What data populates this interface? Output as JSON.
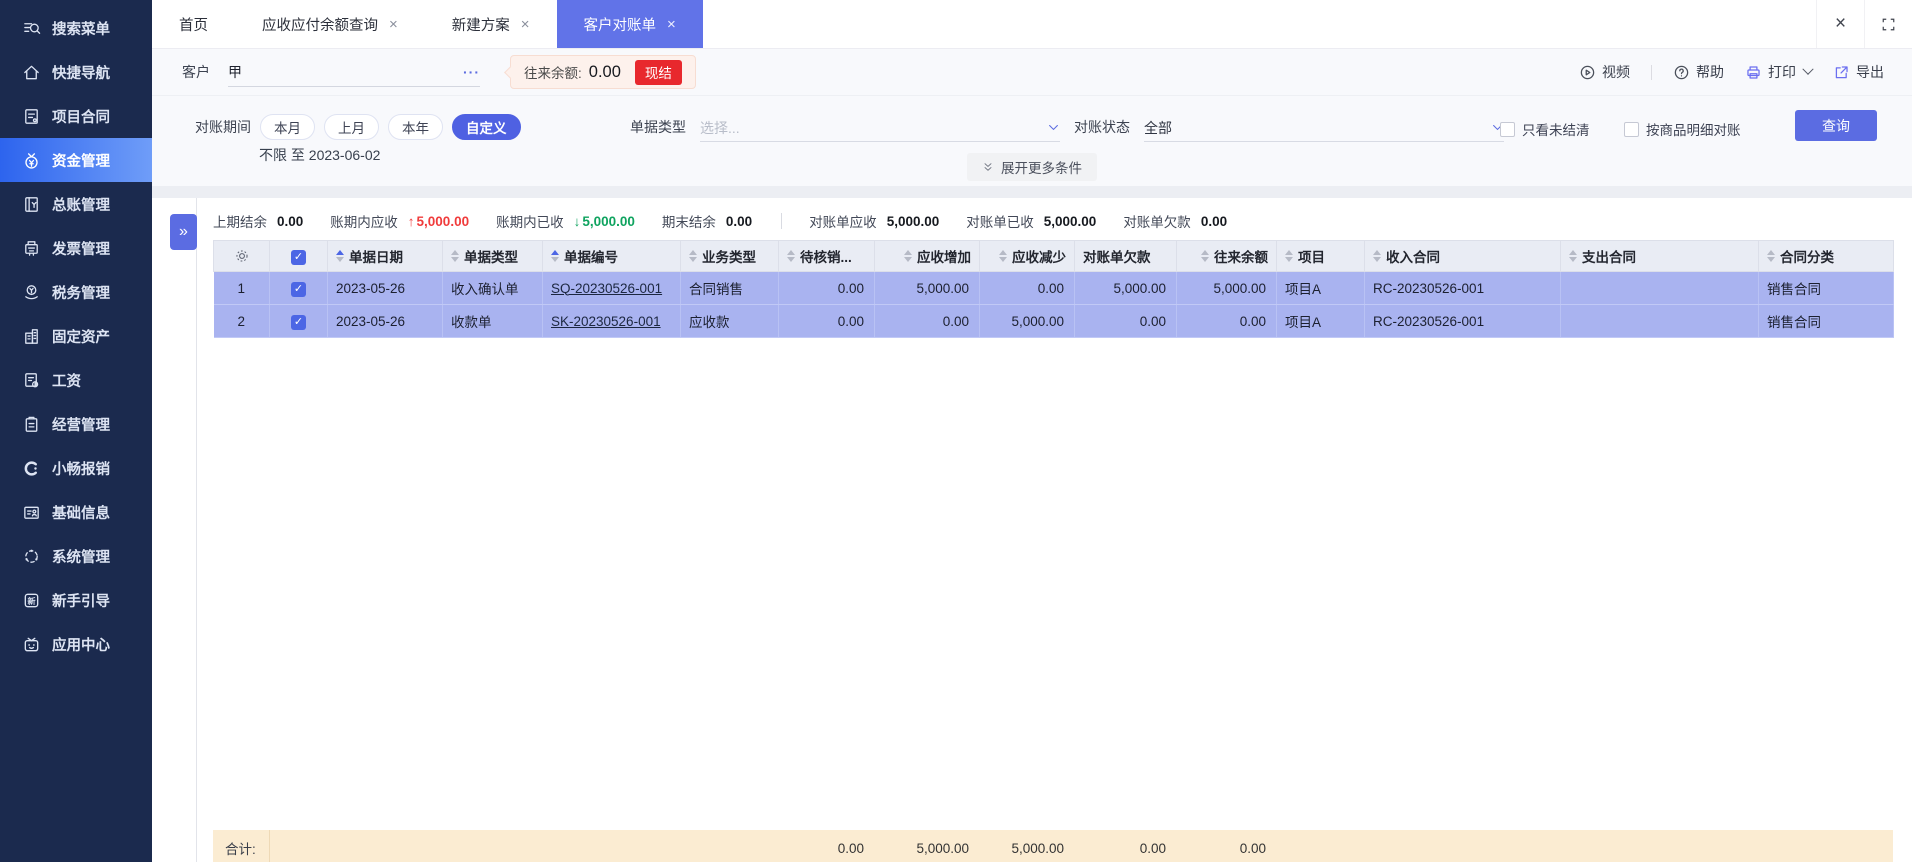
{
  "glyphs": {
    "close": "×",
    "ellipsis": "···",
    "check": "✓",
    "arrow_up": "↑",
    "arrow_down": "↓",
    "expander": "»"
  },
  "colors": {
    "sidebar_bg": "#1b2a4e",
    "accent_blue": "#5b6ce2",
    "active_tab": "#6173e8",
    "row_selected": "#a9b3f0",
    "badge_red": "#e8282d",
    "value_red": "#f03b3b",
    "value_green": "#0fa35f",
    "totals_bg": "#fbecd2"
  },
  "sidebar": {
    "items": [
      {
        "label": "搜索菜单"
      },
      {
        "label": "快捷导航"
      },
      {
        "label": "项目合同"
      },
      {
        "label": "资金管理",
        "active": true
      },
      {
        "label": "总账管理"
      },
      {
        "label": "发票管理"
      },
      {
        "label": "税务管理"
      },
      {
        "label": "固定资产"
      },
      {
        "label": "工资"
      },
      {
        "label": "经营管理"
      },
      {
        "label": "小畅报销"
      },
      {
        "label": "基础信息"
      },
      {
        "label": "系统管理"
      },
      {
        "label": "新手引导"
      },
      {
        "label": "应用中心"
      }
    ]
  },
  "tabs": [
    {
      "label": "首页",
      "closable": false
    },
    {
      "label": "应收应付余额查询",
      "closable": true
    },
    {
      "label": "新建方案",
      "closable": true
    },
    {
      "label": "客户对账单",
      "closable": true,
      "active": true
    }
  ],
  "toolbar": {
    "customer_label": "客户",
    "customer_value": "甲",
    "balance_label": "往来余额:",
    "balance_value": "0.00",
    "balance_badge": "现结",
    "actions": {
      "video": "视频",
      "help": "帮助",
      "print": "打印",
      "export": "导出"
    }
  },
  "filters": {
    "period_label": "对账期间",
    "period_options": [
      "本月",
      "上月",
      "本年",
      "自定义"
    ],
    "period_active": "自定义",
    "period_range": "不限 至 2023-06-02",
    "doc_type_label": "单据类型",
    "doc_type_placeholder": "选择...",
    "status_label": "对账状态",
    "status_value": "全部",
    "checkbox_unsettled": "只看未结清",
    "checkbox_by_product": "按商品明细对账",
    "query_button": "查询",
    "expand_more": "展开更多条件"
  },
  "summary": {
    "items": [
      {
        "label": "上期结余",
        "value": "0.00"
      },
      {
        "label": "账期内应收",
        "value": "5,000.00",
        "trend": "up"
      },
      {
        "label": "账期内已收",
        "value": "5,000.00",
        "trend": "down"
      },
      {
        "label": "期末结余",
        "value": "0.00"
      },
      {
        "label": "对账单应收",
        "value": "5,000.00"
      },
      {
        "label": "对账单已收",
        "value": "5,000.00"
      },
      {
        "label": "对账单欠款",
        "value": "0.00"
      }
    ]
  },
  "table": {
    "columns": [
      {
        "label": "单据日期",
        "sort": "asc"
      },
      {
        "label": "单据类型",
        "sort": "none"
      },
      {
        "label": "单据编号",
        "sort": "asc"
      },
      {
        "label": "业务类型",
        "sort": "none"
      },
      {
        "label": "待核销...",
        "sort": "none"
      },
      {
        "label": "应收增加",
        "sort": "none"
      },
      {
        "label": "应收减少",
        "sort": "none"
      },
      {
        "label": "对账单欠款",
        "sort": null
      },
      {
        "label": "往来余额",
        "sort": "none"
      },
      {
        "label": "项目",
        "sort": "none"
      },
      {
        "label": "收入合同",
        "sort": "none"
      },
      {
        "label": "支出合同",
        "sort": "none"
      },
      {
        "label": "合同分类",
        "sort": "none"
      }
    ],
    "rows": [
      {
        "num": "1",
        "checked": true,
        "date": "2023-05-26",
        "doc_type": "收入确认单",
        "doc_no": "SQ-20230526-001",
        "biz_type": "合同销售",
        "pending": "0.00",
        "receivable_increase": "5,000.00",
        "receivable_decrease": "0.00",
        "statement_due": "5,000.00",
        "balance": "5,000.00",
        "project": "项目A",
        "income_contract": "RC-20230526-001",
        "expense_contract": "",
        "contract_class": "销售合同"
      },
      {
        "num": "2",
        "checked": true,
        "date": "2023-05-26",
        "doc_type": "收款单",
        "doc_no": "SK-20230526-001",
        "biz_type": "应收款",
        "pending": "0.00",
        "receivable_increase": "0.00",
        "receivable_decrease": "5,000.00",
        "statement_due": "0.00",
        "balance": "0.00",
        "project": "项目A",
        "income_contract": "RC-20230526-001",
        "expense_contract": "",
        "contract_class": "销售合同"
      }
    ],
    "totals": {
      "label": "合计:",
      "pending": "0.00",
      "receivable_increase": "5,000.00",
      "receivable_decrease": "5,000.00",
      "statement_due": "0.00",
      "balance": "0.00"
    }
  }
}
